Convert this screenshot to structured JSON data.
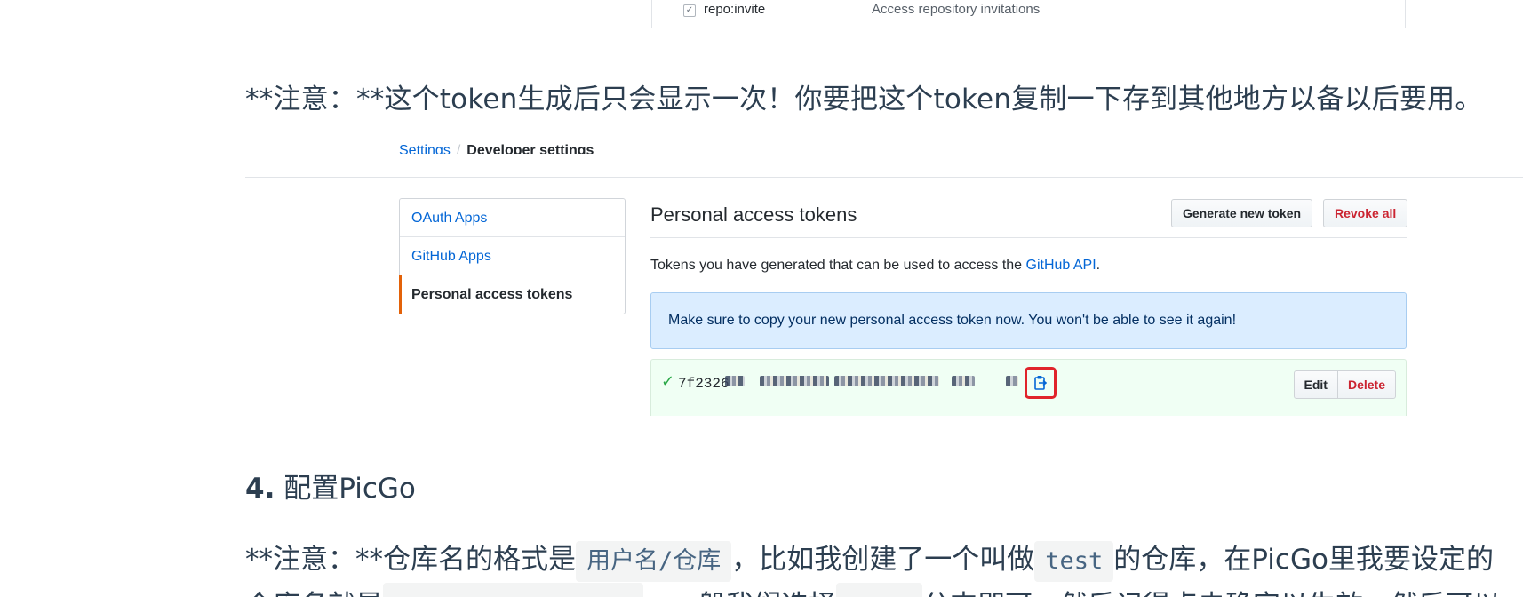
{
  "scope_row": {
    "name": "repo:invite",
    "description": "Access repository invitations"
  },
  "note1": "**注意：**这个token生成后只会显示一次！你要把这个token复制一下存到其他地方以备以后要用。",
  "github": {
    "breadcrumb": {
      "parent": "Settings",
      "separator": "/",
      "current": "Developer settings"
    },
    "sidebar": [
      {
        "label": "OAuth Apps"
      },
      {
        "label": "GitHub Apps"
      },
      {
        "label": "Personal access tokens"
      }
    ],
    "title": "Personal access tokens",
    "generate_button": "Generate new token",
    "revoke_button": "Revoke all",
    "description_prefix": "Tokens you have generated that can be used to access the ",
    "description_link": "GitHub API",
    "description_suffix": ".",
    "flash_message": "Make sure to copy your new personal access token now. You won't be able to see it again!",
    "token_check": "✓",
    "token_prefix": "7f2326",
    "edit_button": "Edit",
    "delete_button": "Delete"
  },
  "heading": {
    "number": "4.",
    "text": " 配置PicGo"
  },
  "note2": {
    "part1": "**注意：**仓库名的格式是",
    "code1": "用户名/仓库",
    "part2": "，比如我创建了一个叫做",
    "code2": "test",
    "part3": "的仓库，在PicGo里我要设定的",
    "line2_start": "仓库名就是",
    "line2_mid": "，一般我们选择",
    "line2_end": "分支即可。然后记得点击确定以生效，然后可以"
  },
  "colors": {
    "link": "#0366d6",
    "danger": "#cb2431",
    "success": "#28a745",
    "highlight_box": "#e0242b",
    "flash_bg": "#dbedff"
  }
}
